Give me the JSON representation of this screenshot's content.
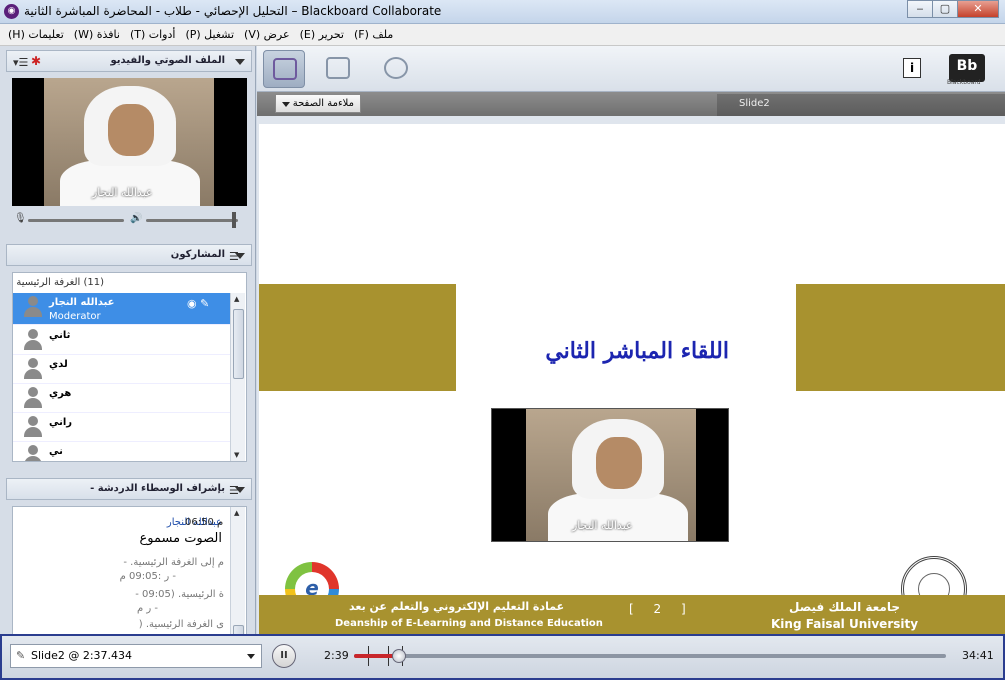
{
  "window": {
    "title": "التحليل الإحصائي - طلاب - المحاضرة المباشرة الثانية – Blackboard Collaborate",
    "app_logo": "collaborate-icon",
    "buttons": {
      "minimize": "‒",
      "maximize": "▢",
      "close": "✕"
    }
  },
  "menu": {
    "items": [
      {
        "label": "ملف (F)"
      },
      {
        "label": "تحرير (E)"
      },
      {
        "label": "عرض (V)"
      },
      {
        "label": "تشغيل (P)"
      },
      {
        "label": "أدوات (T)"
      },
      {
        "label": "نافذة (W)"
      },
      {
        "label": "تعليمات (H)"
      }
    ]
  },
  "audio_video": {
    "title": "الملف الصوتي والفيديو",
    "speaker_name": "عبدالله النجار"
  },
  "participants": {
    "title": "المشاركون",
    "room_label": "(11) الغرفة الرئيسية",
    "items": [
      {
        "name": "عبدالله النجار",
        "role": "Moderator",
        "selected": true
      },
      {
        "name": "ثاني",
        "role": "",
        "selected": false
      },
      {
        "name": "لدي",
        "role": "",
        "selected": false
      },
      {
        "name": "هري",
        "role": "",
        "selected": false
      },
      {
        "name": "راني",
        "role": "",
        "selected": false
      },
      {
        "name": "ني",
        "role": "",
        "selected": false
      }
    ]
  },
  "chat": {
    "title": "بإشراف الوسطاء الدردشة -",
    "sender": "عبدالله النجار",
    "time": "م 06:50",
    "message": "الصوت مسموع",
    "system_lines": [
      "م إلى الغرفة الرئيسية. -",
      "- ر :09:05 م",
      "ة الرئيسية. (09:05 -",
      "- ر م",
      "ى الغرفة الرئيسية. ("
    ]
  },
  "toolbar": {
    "info_label": "i",
    "bb_logo": "Bb",
    "bb_caption": "Blackboard"
  },
  "slide_header": {
    "fit_label": "ملاءمة الصفحة",
    "slide_tab": "Slide2"
  },
  "slide": {
    "title": "اللقاء المباشر الثاني",
    "speaker_name": "عبدالله النجار",
    "footer_left_ar": "عمادة التعليم الإلكتروني والتعلم عن بعد",
    "footer_left_en": "Deanship of E-Learning and Distance Education",
    "footer_page": "[ 2 ]",
    "footer_right_ar": "جامعة الملك فيصل",
    "footer_right_en": "King Faisal University",
    "elogo_letter": "e"
  },
  "playback": {
    "slide_selector": "Slide2 @ 2:37.434",
    "pause_label": "II",
    "current_time": "2:39",
    "total_time": "34:41",
    "progress_fraction": 0.0764
  },
  "colors": {
    "gold_band": "#a8922f",
    "title_blue": "#1c25b0",
    "selection_blue": "#3e8ee6",
    "progress_red": "#c8262b"
  }
}
